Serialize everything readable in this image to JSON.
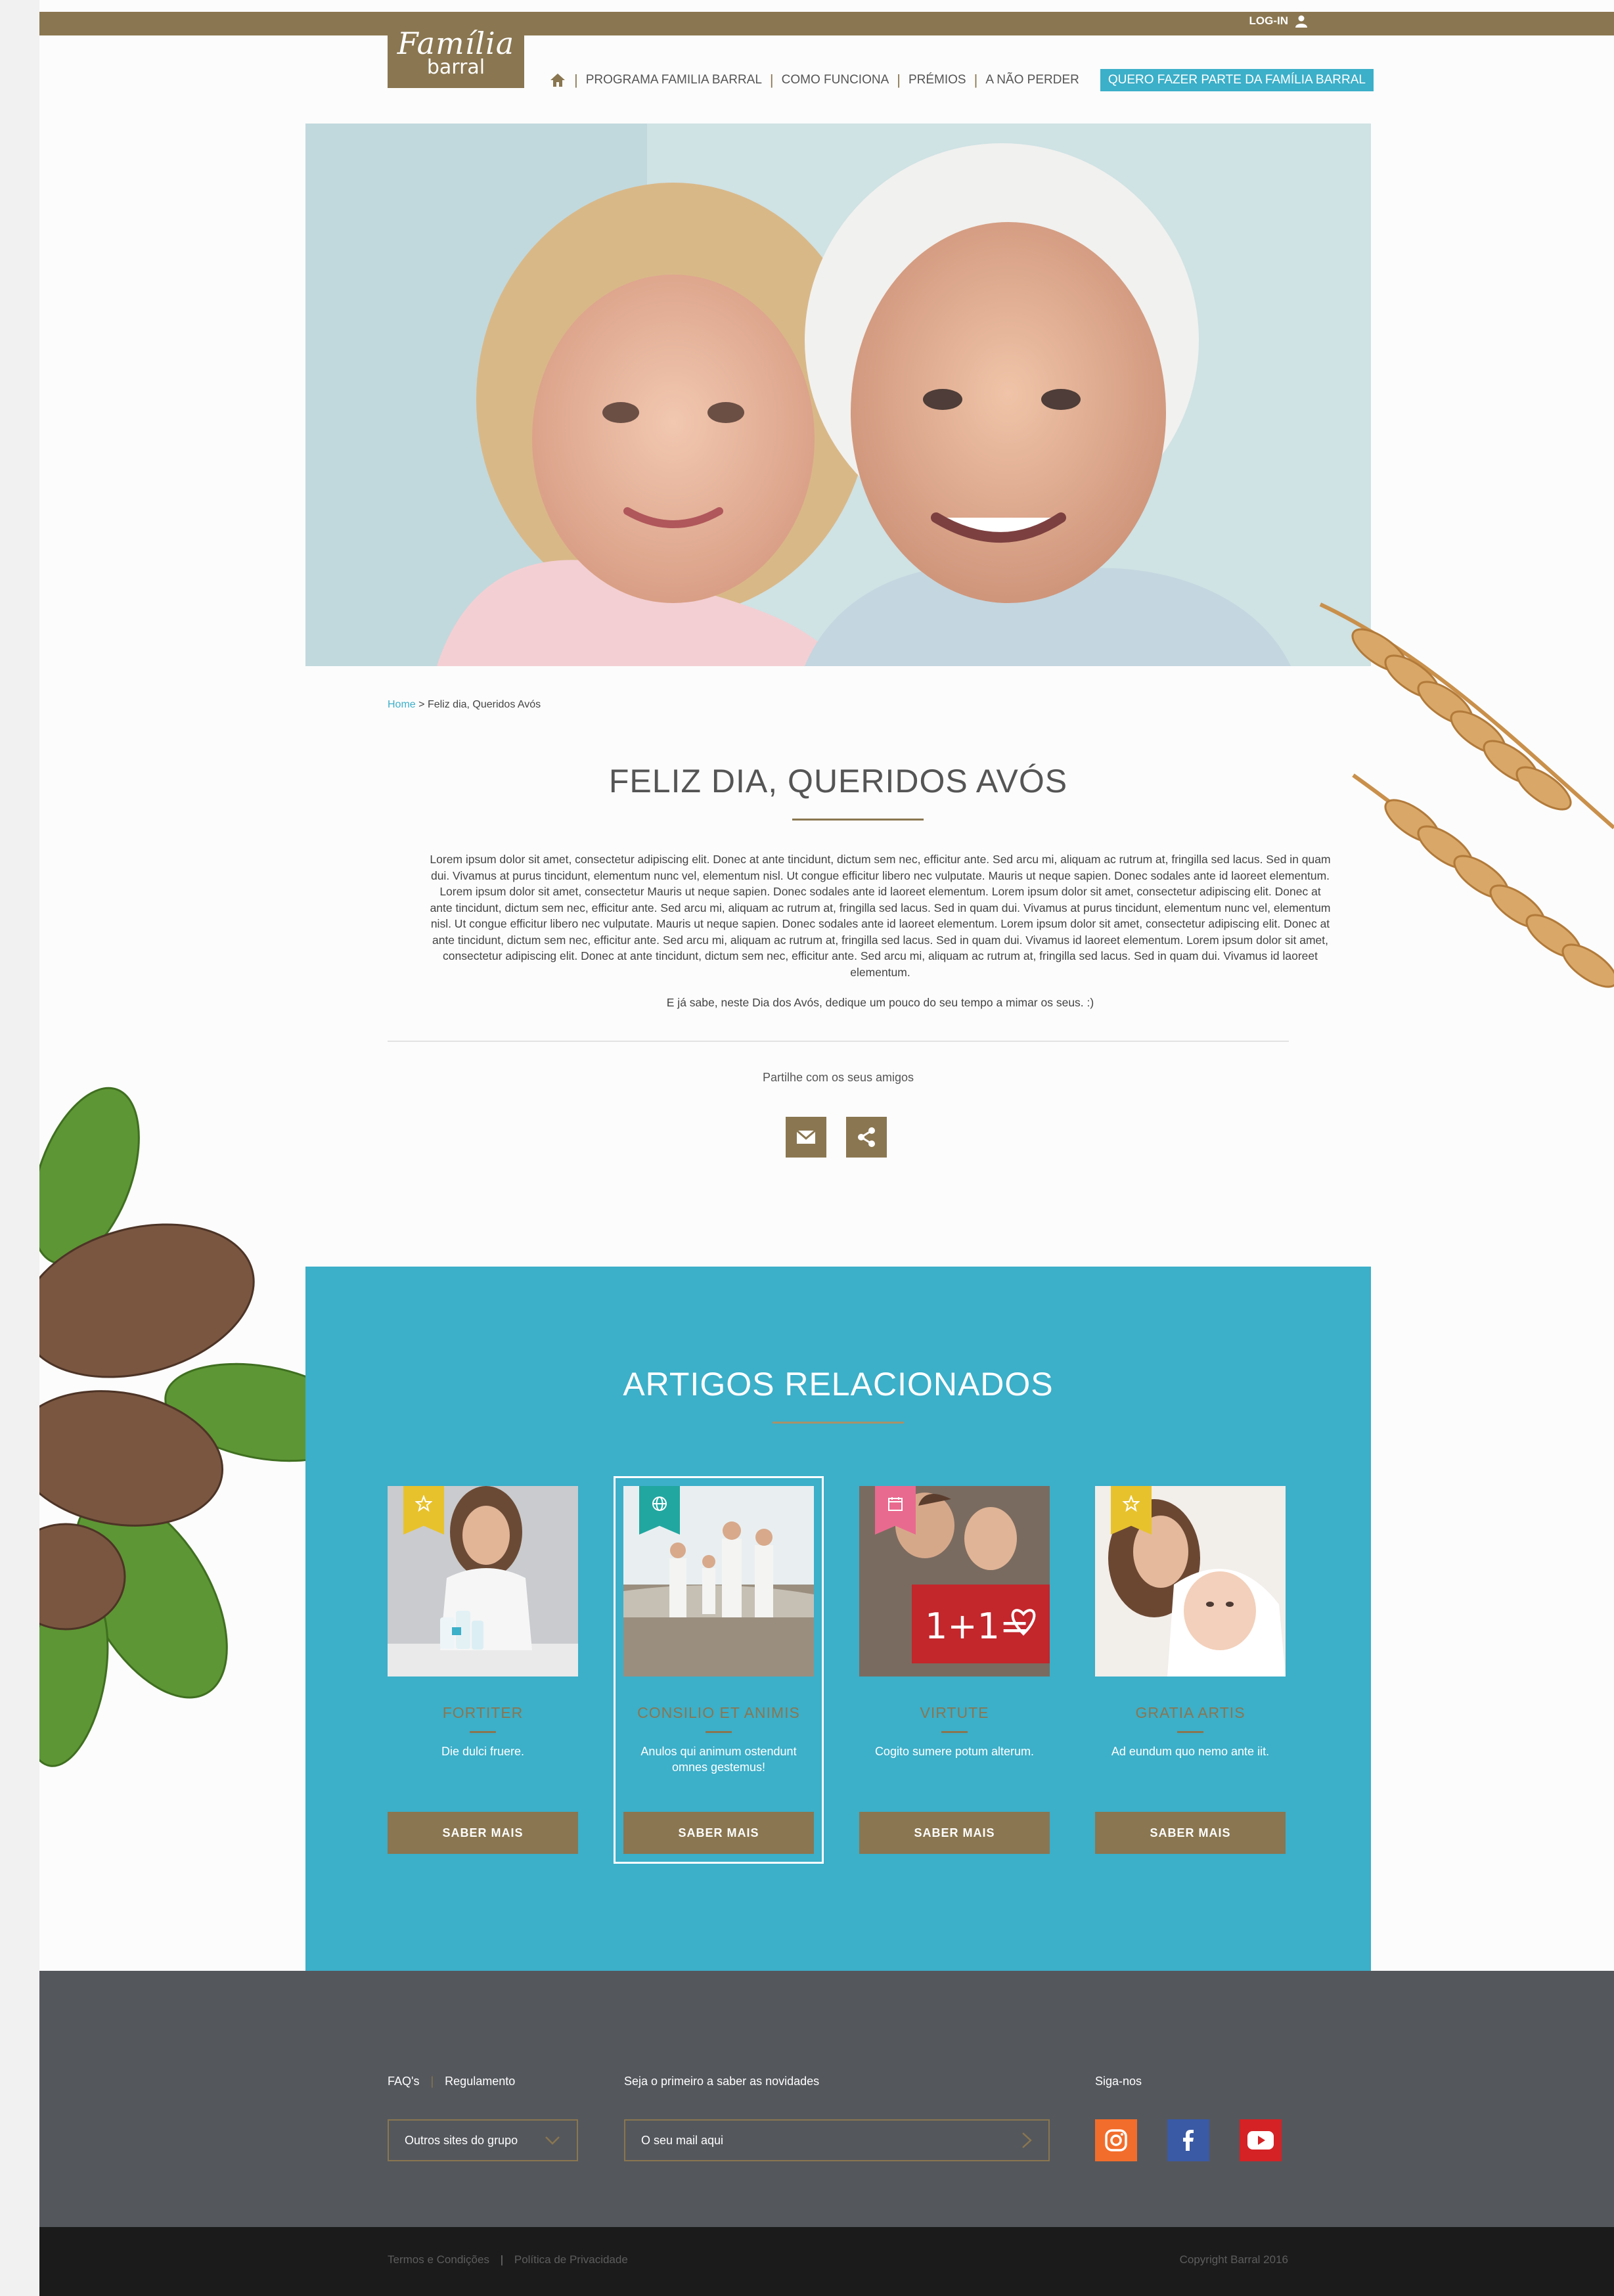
{
  "header": {
    "login_label": "LOG-IN",
    "logo_script": "Família",
    "logo_brand": "barral",
    "nav": [
      {
        "label": "PROGRAMA FAMILIA BARRAL"
      },
      {
        "label": "COMO FUNCIONA"
      },
      {
        "label": "PRÉMIOS"
      },
      {
        "label": "A NÃO PERDER"
      }
    ],
    "cta_label": "QUERO FAZER PARTE DA FAMÍLIA BARRAL"
  },
  "breadcrumb": {
    "home": "Home",
    "separator": ">",
    "current": "Feliz dia, Queridos Avós"
  },
  "article": {
    "title": "FELIZ DIA, QUERIDOS AVÓS",
    "paragraph": "Lorem ipsum dolor sit amet, consectetur adipiscing elit. Donec at ante tincidunt, dictum sem nec, efficitur ante. Sed arcu mi, aliquam ac rutrum at, fringilla sed lacus. Sed in quam dui. Vivamus at purus tincidunt, elementum nunc vel, elementum nisl. Ut congue efficitur libero nec vulputate. Mauris ut neque sapien. Donec sodales ante id laoreet elementum. Lorem ipsum dolor sit amet, consectetur Mauris ut neque sapien. Donec sodales ante id laoreet elementum. Lorem ipsum dolor sit amet, consectetur adipiscing elit. Donec at ante tincidunt, dictum sem nec, efficitur ante. Sed arcu mi, aliquam ac rutrum at, fringilla sed lacus. Sed in quam dui. Vivamus at purus tincidunt, elementum nunc vel, elementum nisl. Ut congue efficitur libero nec vulputate. Mauris ut neque sapien. Donec sodales ante id laoreet elementum. Lorem ipsum dolor sit amet, consectetur adipiscing elit. Donec at ante tincidunt, dictum sem nec, efficitur ante. Sed arcu mi, aliquam ac rutrum at, fringilla sed lacus. Sed in quam dui. Vivamus id laoreet elementum. Lorem ipsum dolor sit amet, consectetur adipiscing elit. Donec at ante tincidunt, dictum sem nec, efficitur ante. Sed arcu mi, aliquam ac rutrum at, fringilla sed lacus. Sed in quam dui. Vivamus id laoreet elementum.",
    "closing": "E já sabe, neste Dia dos Avós, dedique um pouco do seu tempo a mimar os seus. :)",
    "share_label": "Partilhe com os seus amigos"
  },
  "related": {
    "title": "ARTIGOS RELACIONADOS",
    "cards": [
      {
        "title": "FORTITER",
        "text": "Die dulci fruere.",
        "button": "SABER MAIS",
        "flag_icon": "star-icon",
        "flag_color": "#e8c22c"
      },
      {
        "title": "CONSILIO ET ANIMIS",
        "text": "Anulos qui animum ostendunt omnes gestemus!",
        "button": "SABER MAIS",
        "flag_icon": "globe-icon",
        "flag_color": "#21a7a0"
      },
      {
        "title": "VIRTUTE",
        "text": "Cogito sumere potum alterum.",
        "button": "SABER MAIS",
        "flag_icon": "calendar-icon",
        "flag_color": "#e96a8f"
      },
      {
        "title": "GRATIA ARTIS",
        "text": "Ad eundum quo nemo ante iit.",
        "button": "SABER MAIS",
        "flag_icon": "star-icon",
        "flag_color": "#e8c22c"
      }
    ],
    "card3_sign": "1+1="
  },
  "footer": {
    "faqs": "FAQ's",
    "regulamento": "Regulamento",
    "newsletter_label": "Seja o primeiro a saber as novidades",
    "follow_label": "Siga-nos",
    "select_value": "Outros sites do grupo",
    "email_placeholder": "O seu mail aqui",
    "terms": "Termos e Condições",
    "privacy": "Política de Privacidade",
    "copyright": "Copyright Barral 2016"
  },
  "colors": {
    "brand_gold": "#8a7650",
    "accent_blue": "#3cafc9",
    "footer_gray": "#54575c"
  }
}
